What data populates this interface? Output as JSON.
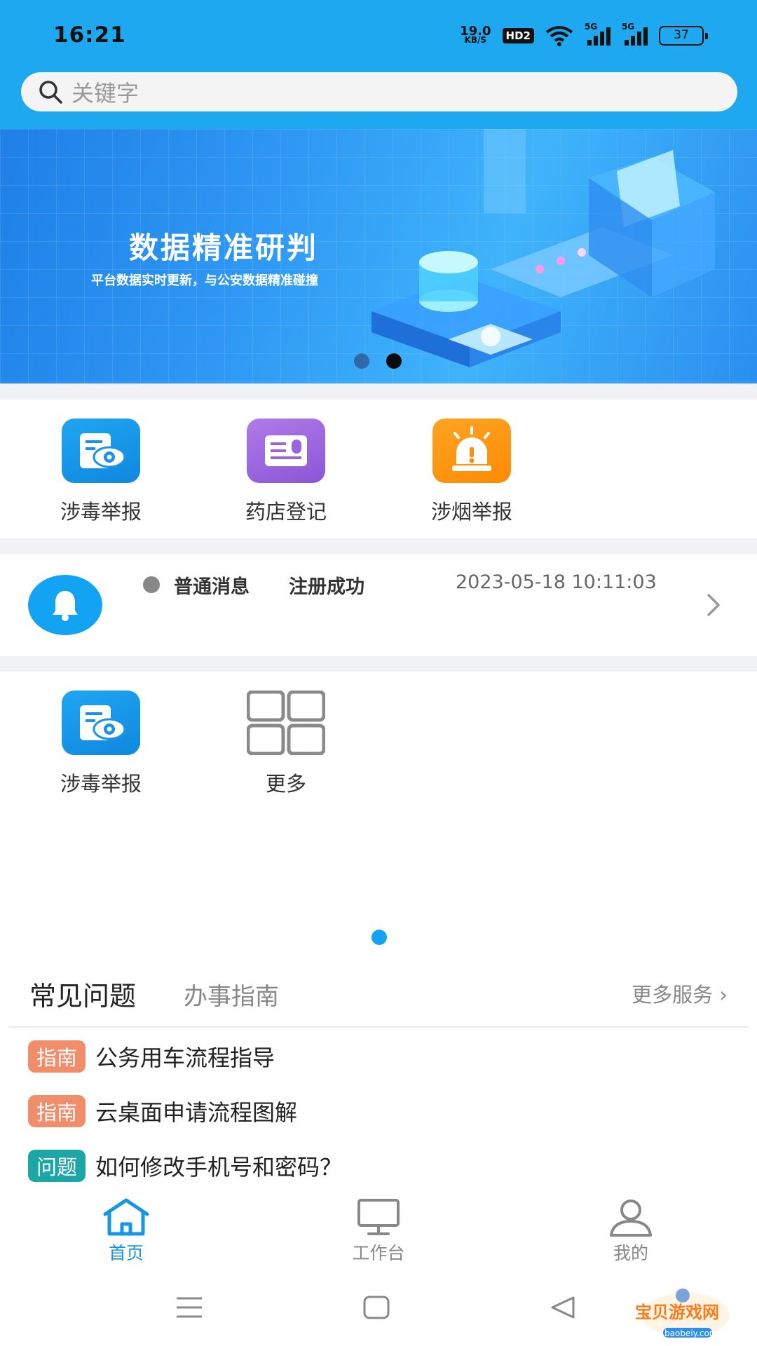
{
  "status_bar": {
    "time": "16:21",
    "net_speed": "19.0",
    "net_unit": "KB/S",
    "hd": "HD2",
    "sim1": "5G",
    "sim2": "5G",
    "battery": "37"
  },
  "search": {
    "placeholder": "关键字"
  },
  "banner": {
    "title": "数据精准研判",
    "subtitle": "平台数据实时更新，与公安数据精准碰撞",
    "page_count": 2,
    "active_page": 2
  },
  "quick_entries": [
    {
      "label": "涉毒举报",
      "icon": "eye-document-icon",
      "color": "#1296e8"
    },
    {
      "label": "药店登记",
      "icon": "id-card-icon",
      "color": "#9b63df"
    },
    {
      "label": "涉烟举报",
      "icon": "alarm-light-icon",
      "color": "#ff9510"
    }
  ],
  "notice": {
    "type": "普通消息",
    "title": "注册成功",
    "time": "2023-05-18 10:11:03"
  },
  "services": [
    {
      "label": "涉毒举报",
      "icon": "eye-document-icon"
    },
    {
      "label": "更多",
      "icon": "grid-icon"
    }
  ],
  "faq": {
    "tab_active": "常见问题",
    "tab_other": "办事指南",
    "more_label": "更多服务",
    "items": [
      {
        "tag": "指南",
        "text": "公务用车流程指导"
      },
      {
        "tag": "指南",
        "text": "云桌面申请流程图解"
      },
      {
        "tag": "问题",
        "text": "如何修改手机号和密码？"
      }
    ]
  },
  "bottom_nav": [
    {
      "label": "首页",
      "icon": "home-icon",
      "active": true
    },
    {
      "label": "工作台",
      "icon": "monitor-icon",
      "active": false
    },
    {
      "label": "我的",
      "icon": "user-icon",
      "active": false
    }
  ],
  "watermark": {
    "text": "宝贝游戏网",
    "url_text": "baobeiy.com"
  },
  "colors": {
    "primary": "#1ea8f0",
    "guide_tag": "#f08d6a",
    "question_tag": "#1ca6a6"
  }
}
